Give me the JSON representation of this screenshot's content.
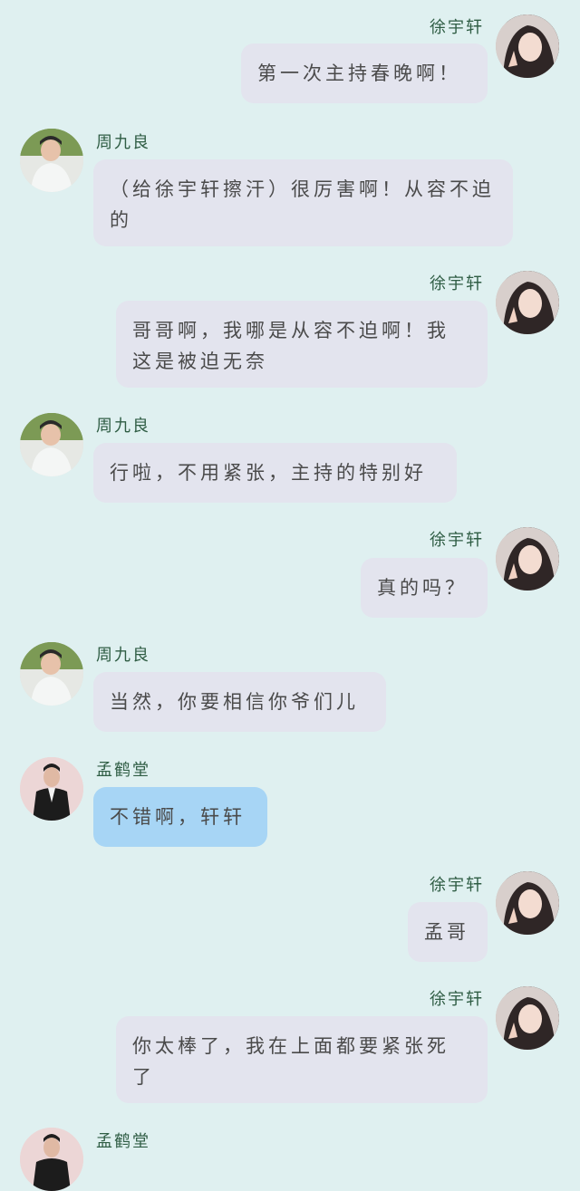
{
  "messages": [
    {
      "sender": "徐宇轩",
      "side": "right",
      "text": "第一次主持春晚啊！"
    },
    {
      "sender": "周九良",
      "side": "left",
      "text": "（给徐宇轩擦汗）很厉害啊！从容不迫的"
    },
    {
      "sender": "徐宇轩",
      "side": "right",
      "text": "哥哥啊，我哪是从容不迫啊！我这是被迫无奈"
    },
    {
      "sender": "周九良",
      "side": "left",
      "text": "行啦，不用紧张，主持的特别好"
    },
    {
      "sender": "徐宇轩",
      "side": "right",
      "text": "真的吗？"
    },
    {
      "sender": "周九良",
      "side": "left",
      "text": "当然，你要相信你爷们儿"
    },
    {
      "sender": "孟鹤堂",
      "side": "left",
      "text": "不错啊，轩轩",
      "bubble_color": "#a7d5f5"
    },
    {
      "sender": "徐宇轩",
      "side": "right",
      "text": "孟哥"
    },
    {
      "sender": "徐宇轩",
      "side": "right",
      "text": "你太棒了，我在上面都要紧张死了"
    },
    {
      "sender": "孟鹤堂",
      "side": "left",
      "text": ""
    }
  ],
  "colors": {
    "background": "#dff0f0",
    "bubble": "#e3e4ee",
    "bubble_highlight": "#a7d5f5",
    "name": "#2f5d44"
  }
}
